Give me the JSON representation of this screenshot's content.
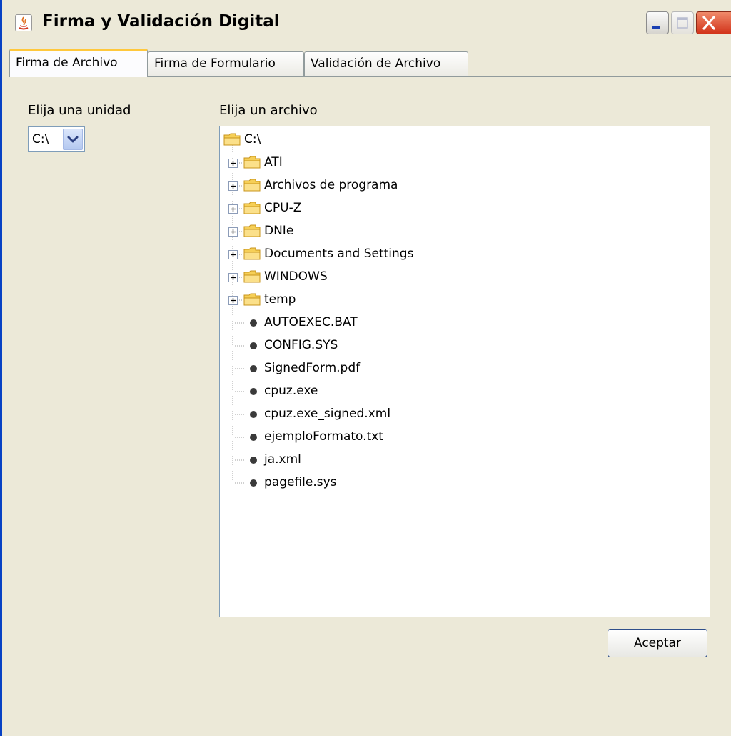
{
  "window": {
    "title": "Firma y Validación Digital"
  },
  "tabs": [
    {
      "label": "Firma de Archivo",
      "active": true
    },
    {
      "label": "Firma de Formulario",
      "active": false
    },
    {
      "label": "Validación de Archivo",
      "active": false
    }
  ],
  "drive": {
    "label": "Elija una unidad",
    "selected": "C:\\"
  },
  "file_tree": {
    "label": "Elija un archivo",
    "root": "C:\\",
    "folders": [
      "ATI",
      "Archivos de programa",
      "CPU-Z",
      "DNIe",
      "Documents and Settings",
      "WINDOWS",
      "temp"
    ],
    "files": [
      "AUTOEXEC.BAT",
      "CONFIG.SYS",
      "SignedForm.pdf",
      "cpuz.exe",
      "cpuz.exe_signed.xml",
      "ejemploFormato.txt",
      "ja.xml",
      "pagefile.sys"
    ]
  },
  "accept_label": "Aceptar",
  "icons": [
    "java-icon",
    "minimize-icon",
    "maximize-icon",
    "close-icon",
    "chevron-down-icon",
    "folder-icon",
    "expand-icon",
    "file-bullet-icon"
  ],
  "colors": {
    "window_bg": "#ece9d8",
    "active_tab_highlight": "#ffc83c",
    "close_button": "#d2331a",
    "folder": "#f6cf57"
  }
}
